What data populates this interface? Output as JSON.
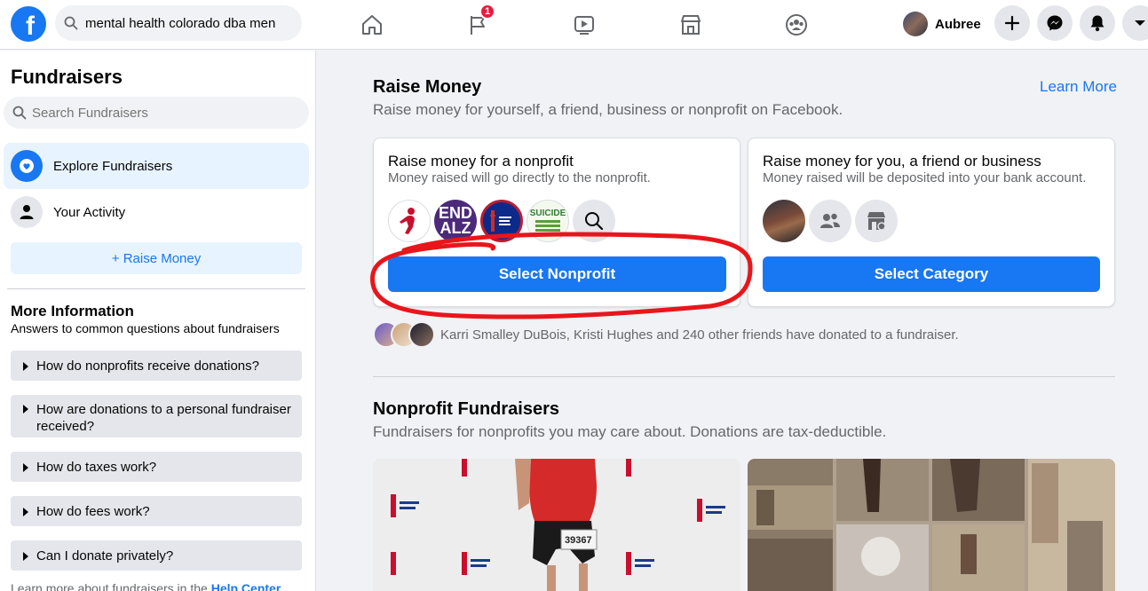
{
  "topbar": {
    "logo_letter": "f",
    "search_value": "mental health colorado dba men",
    "notification_count": "1",
    "profile_name": "Aubree"
  },
  "sidebar": {
    "title": "Fundraisers",
    "search_placeholder": "Search Fundraisers",
    "items": [
      {
        "label": "Explore Fundraisers"
      },
      {
        "label": "Your Activity"
      }
    ],
    "raise_money_label": "+ Raise Money",
    "more_info_title": "More Information",
    "more_info_sub": "Answers to common questions about fundraisers",
    "faqs": [
      "How do nonprofits receive donations?",
      "How are donations to a personal fundraiser received?",
      "How do taxes work?",
      "How do fees work?",
      "Can I donate privately?"
    ],
    "footer_text": "Learn more about fundraisers in the ",
    "footer_link": "Help Center"
  },
  "main": {
    "raise_title": "Raise Money",
    "raise_sub": "Raise money for yourself, a friend, business or nonprofit on Facebook.",
    "learn_more": "Learn More",
    "nonprofit_card": {
      "title": "Raise money for a nonprofit",
      "sub": "Money raised will go directly to the nonprofit.",
      "logos": [
        "St. Jude",
        "END ALZ",
        "American Cancer Society",
        "SUICIDE PREVENTION LIFELINE"
      ],
      "logo_text_end": "END",
      "logo_text_alz": "ALZ",
      "logo_text_suicide": "SUICIDE",
      "button": "Select Nonprofit"
    },
    "personal_card": {
      "title": "Raise money for you, a friend or business",
      "sub": "Money raised will be deposited into your bank account.",
      "button": "Select Category"
    },
    "friends_text": "Karri Smalley DuBois, Kristi Hughes and 240 other friends have donated to a fundraiser.",
    "nonprofit_title": "Nonprofit Fundraisers",
    "nonprofit_sub": "Fundraisers for nonprofits you may care about. Donations are tax-deductible.",
    "bib_number": "39367"
  },
  "colors": {
    "brand": "#1877f2",
    "badge": "#e41e3f",
    "annotation": "#e8161b"
  }
}
